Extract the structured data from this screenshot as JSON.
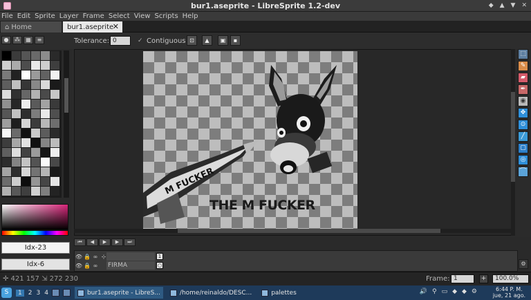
{
  "window": {
    "title": "bur1.aseprite - LibreSprite 1.2-dev",
    "controls": [
      "◆",
      "▲",
      "▼",
      "✕"
    ]
  },
  "menu": [
    "File",
    "Edit",
    "Sprite",
    "Layer",
    "Frame",
    "Select",
    "View",
    "Scripts",
    "Help"
  ],
  "tabs": {
    "home": "Home",
    "active": "bur1.aseprite",
    "home_icon": "⌂",
    "close": "✕"
  },
  "toolbar": {
    "tolerance_label": "Tolerance:",
    "tolerance_value": "0",
    "contiguous_label": "Contiguous",
    "contiguous_checked": true,
    "check_glyph": "✓",
    "buttons": [
      "⊡",
      "▲",
      "▣",
      "▪"
    ]
  },
  "palette_tools": [
    "●",
    "⁂",
    "▦",
    "≡"
  ],
  "palette": {
    "swatches": [
      "#000000",
      "#3b3b3b",
      "#555555",
      "#6a6a6a",
      "#8c8c8c",
      "#2a2a2a",
      "#d0d0d0",
      "#aaaaaa",
      "#4d4d4d",
      "#e9e9e9",
      "#cfcfcf",
      "#3e3e3e",
      "#7a7a7a",
      "#222222",
      "#fefefe",
      "#9a9a9a",
      "#616161",
      "#f2f2f2",
      "#5e5e5e",
      "#bfbfbf",
      "#363636",
      "#888888",
      "#d9d9d9",
      "#1a1a1a",
      "#dbdbdb",
      "#303030",
      "#676767",
      "#b2b2b2",
      "#4a4a4a",
      "#c6c6c6",
      "#8f8f8f",
      "#262626",
      "#ececec",
      "#5a5a5a",
      "#a2a2a2",
      "#3a3a3a",
      "#565656",
      "#c0c0c0",
      "#2e2e2e",
      "#7d7d7d",
      "#eaeaea",
      "#4f4f4f",
      "#9e9e9e",
      "#1e1e1e",
      "#d4d4d4",
      "#3c3c3c",
      "#b8b8b8",
      "#6e6e6e",
      "#f6f6f6",
      "#6b6b6b",
      "#121212",
      "#cacaca",
      "#5c5c5c",
      "#2a2a2a",
      "#3d3d3d",
      "#a7a7a7",
      "#e1e1e1",
      "#101010",
      "#858585",
      "#bcbcbc",
      "#5f5f5f",
      "#dedede",
      "#424242",
      "#9b9b9b",
      "#161616",
      "#eeeeee",
      "#2c2c2c",
      "#838383",
      "#c3c3c3",
      "#535353",
      "#fafafa",
      "#484848",
      "#a4a4a4",
      "#2d2d2d",
      "#d6d6d6",
      "#737373",
      "#b5b5b5",
      "#191919",
      "#6c6c6c",
      "#cdcdcd",
      "#0d0d0d",
      "#959595",
      "#464646",
      "#e4e4e4",
      "#b1b1b1",
      "#585858",
      "#3f3f3f",
      "#d1d1d1",
      "#7f7f7f",
      "#232323"
    ],
    "fg_index": "Idx-23",
    "bg_index": "Idx-6"
  },
  "canvas": {
    "caption": "THE M FUCKER"
  },
  "right_tools": [
    "⬚",
    "✎",
    "▰",
    "✒",
    "◉",
    "✥",
    "⊙",
    "╱",
    "▢",
    "◎",
    "⌒"
  ],
  "timeline": {
    "buttons": [
      "⏮",
      "◀",
      "▶",
      "▶",
      "⏭"
    ],
    "layers": [
      {
        "icons": [
          "👁",
          "🔒",
          "∞",
          "⊹"
        ],
        "name": "",
        "frame": "1"
      },
      {
        "icons": [
          "👁",
          "🔒",
          "∞"
        ],
        "name": "FIRMA",
        "frame": "○"
      }
    ],
    "config": "⚙"
  },
  "status": {
    "coords": "✛ 421 157  ⇲ 272 230",
    "frame_label": "Frame:",
    "frame_value": "1",
    "plus": "+",
    "zoom": "100.0%"
  },
  "taskbar": {
    "start": "S",
    "desktops": [
      "1",
      "2",
      "3",
      "4"
    ],
    "tasks": [
      "bur1.aseprite - LibreS...",
      "/home/reinaldo/DESC...",
      "palettes"
    ],
    "tray": [
      "🔊",
      "⚲",
      "▭",
      "◆",
      "◆",
      "⚙"
    ],
    "clock_time": "6:44 P. M.",
    "clock_date": "jue, 21 ago."
  }
}
